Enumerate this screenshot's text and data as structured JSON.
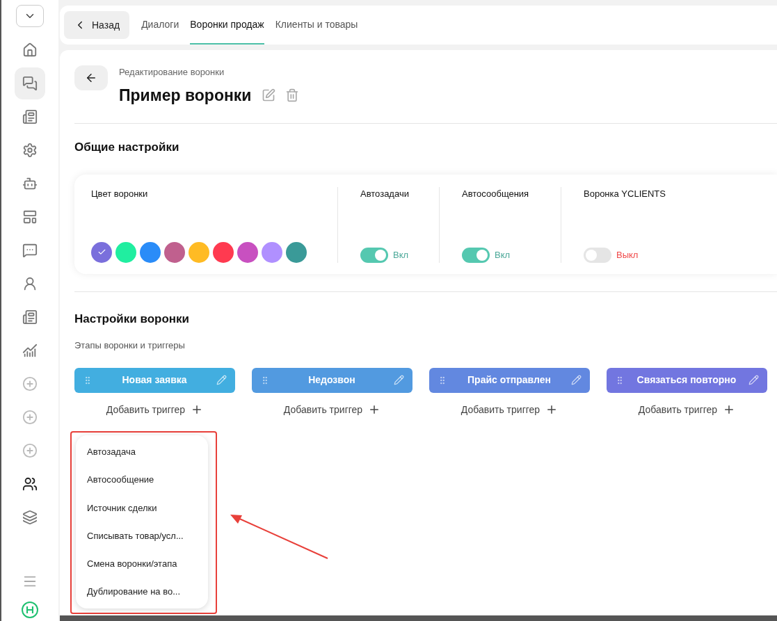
{
  "sidebar": {
    "items": [
      {
        "kind": "home",
        "selected": false
      },
      {
        "kind": "chat",
        "selected": true
      },
      {
        "kind": "news",
        "selected": false
      },
      {
        "kind": "settings",
        "selected": false
      },
      {
        "kind": "bot",
        "selected": false
      },
      {
        "kind": "layout",
        "selected": false
      },
      {
        "kind": "smile",
        "selected": false
      },
      {
        "kind": "user",
        "selected": false
      },
      {
        "kind": "news",
        "selected": false
      },
      {
        "kind": "chart",
        "selected": false
      },
      {
        "kind": "add",
        "selected": false
      },
      {
        "kind": "add",
        "selected": false
      },
      {
        "kind": "add",
        "selected": false
      },
      {
        "kind": "team",
        "selected": false
      },
      {
        "kind": "stack",
        "selected": false
      }
    ]
  },
  "top_bar": {
    "back": "Назад",
    "tabs": [
      {
        "label": "Диалоги",
        "selected": false
      },
      {
        "label": "Воронки продаж",
        "selected": true
      },
      {
        "label": "Клиенты и товары",
        "selected": false
      }
    ]
  },
  "header": {
    "subtitle": "Редактирование воронки",
    "title": "Пример воронки"
  },
  "general": {
    "title": "Общие настройки",
    "color_label": "Цвет воронки",
    "swatches": [
      {
        "color": "#7a6fdc",
        "selected": true
      },
      {
        "color": "#20eea0",
        "selected": false
      },
      {
        "color": "#2a8cf8",
        "selected": false
      },
      {
        "color": "#c0608e",
        "selected": false
      },
      {
        "color": "#ffbb24",
        "selected": false
      },
      {
        "color": "#ff3a50",
        "selected": false
      },
      {
        "color": "#c850c0",
        "selected": false
      },
      {
        "color": "#b090ff",
        "selected": false
      },
      {
        "color": "#3a9a98",
        "selected": false
      }
    ],
    "toggles": [
      {
        "label": "Автозадачи",
        "on": true,
        "state": "Вкл"
      },
      {
        "label": "Автосообщения",
        "on": true,
        "state": "Вкл"
      },
      {
        "label": "Воронка YCLIENTS",
        "on": false,
        "state": "Выкл"
      }
    ]
  },
  "funnel": {
    "title": "Настройки воронки",
    "subtitle": "Этапы воронки и триггеры",
    "stages": [
      {
        "name": "Новая заявка",
        "color": "#42aee0",
        "add": "Добавить триггер"
      },
      {
        "name": "Недозвон",
        "color": "#529ae0",
        "add": "Добавить триггер"
      },
      {
        "name": "Прайс отправлен",
        "color": "#6288e0",
        "add": "Добавить триггер"
      },
      {
        "name": "Связаться повторно",
        "color": "#7276e0",
        "add": "Добавить триггер"
      }
    ]
  },
  "trigger_menu": [
    "Автозадача",
    "Автосообщение",
    "Источник сделки",
    "Списывать товар/усл...",
    "Смена воронки/этапа",
    "Дублирование на во..."
  ]
}
